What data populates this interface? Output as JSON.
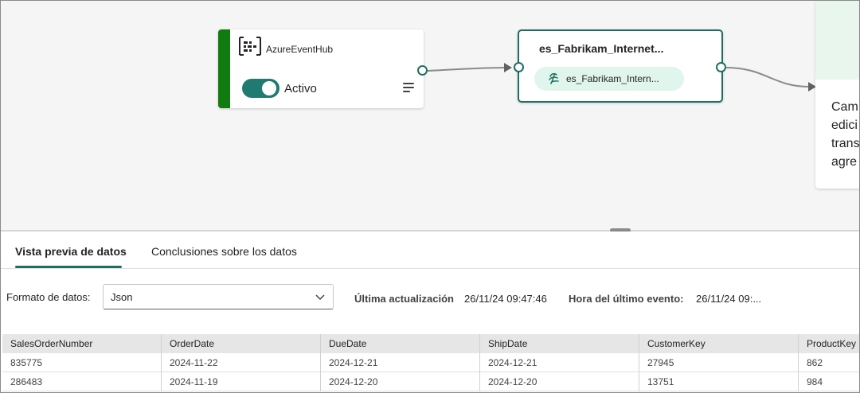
{
  "canvas": {
    "source_node": {
      "title": "AzureEventHub",
      "toggle_label": "Activo",
      "toggle_on": true,
      "accent_color": "#107c10"
    },
    "stream_node": {
      "title": "es_Fabrikam_Internet...",
      "stream_label": "es_Fabrikam_Intern..."
    },
    "destination_node": {
      "text": "Cam\nedici\ntrans\nagre"
    }
  },
  "tabs": [
    {
      "label": "Vista previa de datos",
      "active": true
    },
    {
      "label": "Conclusiones sobre los datos",
      "active": false
    }
  ],
  "format_bar": {
    "format_label": "Formato de datos:",
    "format_value": "Json",
    "last_update_label": "Última actualización",
    "last_update_value": "26/11/24 09:47:46",
    "last_event_label": "Hora del último evento:",
    "last_event_value": "26/11/24 09:..."
  },
  "table": {
    "columns": [
      "SalesOrderNumber",
      "OrderDate",
      "DueDate",
      "ShipDate",
      "CustomerKey",
      "ProductKey"
    ],
    "rows": [
      [
        "835775",
        "2024-11-22",
        "2024-12-21",
        "2024-12-21",
        "27945",
        "862"
      ],
      [
        "286483",
        "2024-11-19",
        "2024-12-20",
        "2024-12-20",
        "13751",
        "984"
      ]
    ]
  },
  "colors": {
    "accent": "#1f6e63",
    "source_accent": "#107c10",
    "pill_bg": "#e0f5ec"
  }
}
